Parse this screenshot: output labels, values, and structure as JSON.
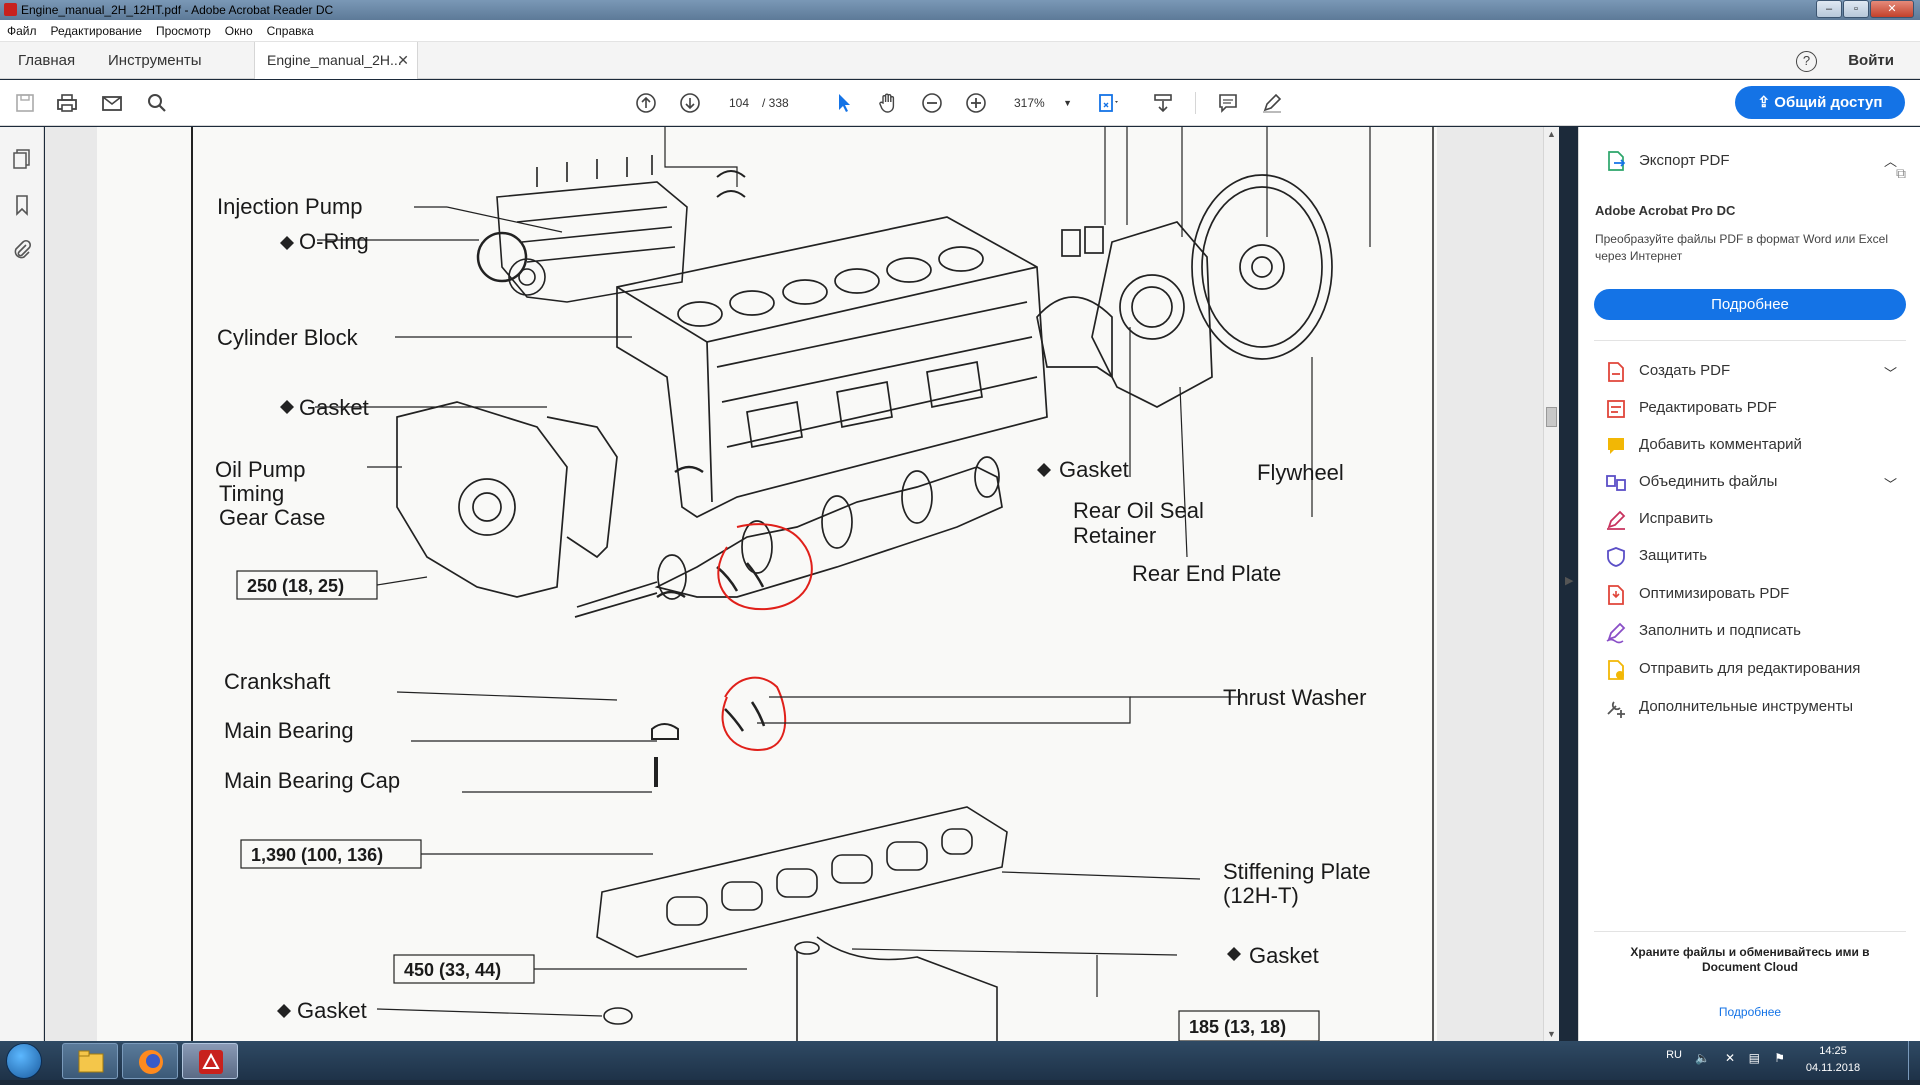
{
  "window": {
    "title": "Engine_manual_2H_12HT.pdf - Adobe Acrobat Reader DC"
  },
  "menu": [
    "Файл",
    "Редактирование",
    "Просмотр",
    "Окно",
    "Справка"
  ],
  "tabs": {
    "home": "Главная",
    "tools": "Инструменты",
    "document": "Engine_manual_2H..."
  },
  "signin": "Войти",
  "toolbar": {
    "page_current": "104",
    "page_total": "/ 338",
    "zoom": "317%",
    "share": "Общий доступ"
  },
  "diagram": {
    "labels": {
      "injection_pump": "Injection Pump",
      "o_ring": "O-Ring",
      "cylinder_block": "Cylinder Block",
      "gasket1": "Gasket",
      "oil_pump": "Oil Pump",
      "timing": "Timing",
      "gear_case": "Gear Case",
      "torque1": "250 (18, 25)",
      "crankshaft": "Crankshaft",
      "main_bearing": "Main Bearing",
      "main_bearing_cap": "Main Bearing Cap",
      "torque2": "1,390 (100, 136)",
      "torque3": "450 (33, 44)",
      "gasket_bottom": "Gasket",
      "gasket_rear": "Gasket",
      "rear_oil_seal": "Rear Oil Seal",
      "retainer": "Retainer",
      "rear_end_plate": "Rear End Plate",
      "flywheel": "Flywheel",
      "thrust_washer": "Thrust Washer",
      "stiffening_plate": "Stiffening Plate",
      "stiffening_variant": "(12H-T)",
      "gasket_right": "Gasket",
      "torque4": "185 (13, 18)"
    }
  },
  "right_pane": {
    "export": "Экспорт PDF",
    "pro_title": "Adobe Acrobat Pro DC",
    "pro_desc": "Преобразуйте файлы PDF в формат Word или Excel через Интернет",
    "pro_button": "Подробнее",
    "tools": [
      {
        "label": "Создать PDF",
        "icon": "create-pdf-icon",
        "color": "#e0453a"
      },
      {
        "label": "Редактировать PDF",
        "icon": "edit-pdf-icon",
        "color": "#e0453a"
      },
      {
        "label": "Добавить комментарий",
        "icon": "comment-icon",
        "color": "#f2b705"
      },
      {
        "label": "Объединить файлы",
        "icon": "combine-files-icon",
        "color": "#5b4fc7"
      },
      {
        "label": "Исправить",
        "icon": "fix-icon",
        "color": "#c8335e"
      },
      {
        "label": "Защитить",
        "icon": "protect-icon",
        "color": "#5b4fc7"
      },
      {
        "label": "Оптимизировать PDF",
        "icon": "optimize-pdf-icon",
        "color": "#e0453a"
      },
      {
        "label": "Заполнить и подписать",
        "icon": "fill-sign-icon",
        "color": "#8a4fc7"
      },
      {
        "label": "Отправить для редактирования",
        "icon": "send-review-icon",
        "color": "#f2b705"
      },
      {
        "label": "Дополнительные инструменты",
        "icon": "more-tools-icon",
        "color": "#555555"
      }
    ],
    "footer": "Храните файлы и обменивайтесь ими в Document Cloud",
    "footer_link": "Подробнее"
  },
  "taskbar": {
    "lang": "RU",
    "time": "14:25",
    "date": "04.11.2018"
  },
  "colors": {
    "accent": "#1473e6",
    "annotation": "#e0201a"
  }
}
